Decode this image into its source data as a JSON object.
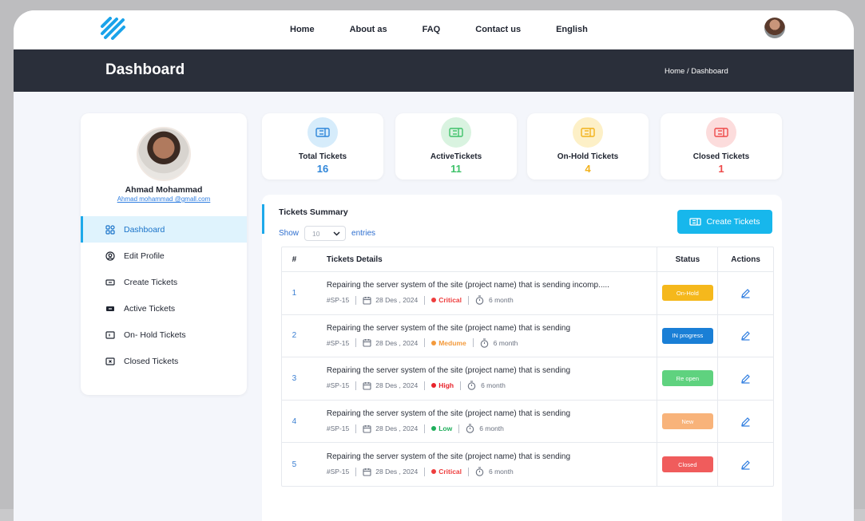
{
  "nav": {
    "links": [
      "Home",
      "About as",
      "FAQ",
      "Contact us",
      "English"
    ]
  },
  "header": {
    "title": "Dashboard",
    "breadcrumb": "Home / Dashboard"
  },
  "profile": {
    "name": "Ahmad Mohammad",
    "email": "Ahmad mohammad @gmall.com"
  },
  "sidebar": {
    "items": [
      {
        "label": "Dashboard",
        "icon": "grid-icon",
        "active": true
      },
      {
        "label": "Edit Profile",
        "icon": "user-circle-icon",
        "active": false
      },
      {
        "label": "Create Tickets",
        "icon": "ticket-icon",
        "active": false
      },
      {
        "label": "Active Tickets",
        "icon": "ticket-filled-icon",
        "active": false
      },
      {
        "label": "On- Hold Tickets",
        "icon": "ticket-hold-icon",
        "active": false
      },
      {
        "label": "Closed Tickets",
        "icon": "ticket-closed-icon",
        "active": false
      }
    ]
  },
  "stats": [
    {
      "label": "Total Tickets",
      "value": "16",
      "color": "#2f86d9",
      "bg": "#d6ecfb"
    },
    {
      "label": "ActiveTickets",
      "value": "11",
      "color": "#3fc26a",
      "bg": "#d9f3e0"
    },
    {
      "label": "On-Hold Tickets",
      "value": "4",
      "color": "#f2b21c",
      "bg": "#fdf0c7"
    },
    {
      "label": "Closed Tickets",
      "value": "1",
      "color": "#ee4a4a",
      "bg": "#fcdcdc"
    }
  ],
  "summary": {
    "title": "Tickets Summary",
    "show_label": "Show",
    "entries_value": "10",
    "entries_label": "entries",
    "create_button": "Create Tickets",
    "columns": [
      "#",
      "Tickets Details",
      "Status",
      "Actions"
    ],
    "rows": [
      {
        "num": "1",
        "title": "Repairing the server system of the site (project name) that is sending incomp.....",
        "id": "#SP-15",
        "date": "28 Des , 2024",
        "priority": "Critical",
        "priority_color": "#ee3d3d",
        "duration": "6 month",
        "status": "On-Hold",
        "status_color": "#f5b81c"
      },
      {
        "num": "2",
        "title": "Repairing the server system of the site (project name) that is sending",
        "id": "#SP-15",
        "date": "28 Des , 2024",
        "priority": "Medume",
        "priority_color": "#f39a3c",
        "duration": "6 month",
        "status": "IN progress",
        "status_color": "#1a7fd6"
      },
      {
        "num": "3",
        "title": "Repairing the server system of the site (project name) that is sending",
        "id": "#SP-15",
        "date": "28 Des , 2024",
        "priority": "High",
        "priority_color": "#e8232b",
        "duration": "6 month",
        "status": "Re open",
        "status_color": "#5fd27f"
      },
      {
        "num": "4",
        "title": "Repairing the server system of the site (project name) that is sending",
        "id": "#SP-15",
        "date": "28 Des , 2024",
        "priority": "Low",
        "priority_color": "#1fae5b",
        "duration": "6 month",
        "status": "New",
        "status_color": "#f8b37a"
      },
      {
        "num": "5",
        "title": "Repairing the server system of the site (project name) that is sending",
        "id": "#SP-15",
        "date": "28 Des , 2024",
        "priority": "Critical",
        "priority_color": "#ee3d3d",
        "duration": "6 month",
        "status": "Closed",
        "status_color": "#f05c5c"
      }
    ]
  }
}
